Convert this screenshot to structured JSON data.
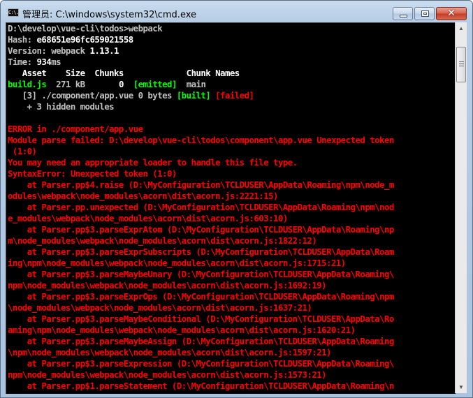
{
  "window": {
    "title": "管理员: C:\\windows\\system32\\cmd.exe",
    "icon": "cmd-icon",
    "icon_text": "C:\\.",
    "buttons": {
      "minimize": "minimize-icon",
      "maximize": "maximize-icon",
      "close": "close-icon",
      "close_glyph": "✕"
    }
  },
  "colors": {
    "console_bg": "#000000",
    "default_text": "#c0c0c0",
    "bright_text": "#ffffff",
    "success": "#00ff00",
    "error": "#ff0000"
  },
  "console": {
    "lines": [
      [
        {
          "t": "D:\\develop\\vue-cli\\todos>webpack",
          "c": "g"
        }
      ],
      [
        {
          "t": "Hash: ",
          "c": "g"
        },
        {
          "t": "e68651e96fc659021558",
          "c": "w"
        }
      ],
      [
        {
          "t": "Version: webpack ",
          "c": "g"
        },
        {
          "t": "1.13.1",
          "c": "w"
        }
      ],
      [
        {
          "t": "Time: ",
          "c": "g"
        },
        {
          "t": "934",
          "c": "w"
        },
        {
          "t": "ms",
          "c": "g"
        }
      ],
      [
        {
          "t": "   Asset    Size  Chunks             Chunk Names",
          "c": "w"
        }
      ],
      [
        {
          "t": "build.js",
          "c": "gr"
        },
        {
          "t": "  271 kB       ",
          "c": "g"
        },
        {
          "t": "0",
          "c": "w"
        },
        {
          "t": "  ",
          "c": "g"
        },
        {
          "t": "[emitted]",
          "c": "gr"
        },
        {
          "t": "  main",
          "c": "g"
        }
      ],
      [
        {
          "t": "   [3] ./component/app.vue 0 bytes ",
          "c": "g"
        },
        {
          "t": "[built]",
          "c": "gr"
        },
        {
          "t": " ",
          "c": "g"
        },
        {
          "t": "[failed]",
          "c": "r"
        }
      ],
      [
        {
          "t": "    + 3 hidden modules",
          "c": "g"
        }
      ],
      [
        {
          "t": "",
          "c": "g"
        }
      ],
      [
        {
          "t": "ERROR in ./component/app.vue",
          "c": "r"
        }
      ],
      [
        {
          "t": "Module parse failed: D:\\develop\\vue-cli\\todos\\component\\app.vue Unexpected token",
          "c": "r"
        }
      ],
      [
        {
          "t": " (1:0)",
          "c": "r"
        }
      ],
      [
        {
          "t": "You may need an appropriate loader to handle this file type.",
          "c": "r"
        }
      ],
      [
        {
          "t": "SyntaxError: Unexpected token (1:0)",
          "c": "r"
        }
      ],
      [
        {
          "t": "    at Parser.pp$4.raise (D:\\MyConfiguration\\TCLDUSER\\AppData\\Roaming\\npm\\node_m",
          "c": "r"
        }
      ],
      [
        {
          "t": "odules\\webpack\\node_modules\\acorn\\dist\\acorn.js:2221:15)",
          "c": "r"
        }
      ],
      [
        {
          "t": "    at Parser.pp.unexpected (D:\\MyConfiguration\\TCLDUSER\\AppData\\Roaming\\npm\\nod",
          "c": "r"
        }
      ],
      [
        {
          "t": "e_modules\\webpack\\node_modules\\acorn\\dist\\acorn.js:603:10)",
          "c": "r"
        }
      ],
      [
        {
          "t": "    at Parser.pp$3.parseExprAtom (D:\\MyConfiguration\\TCLDUSER\\AppData\\Roaming\\np",
          "c": "r"
        }
      ],
      [
        {
          "t": "m\\node_modules\\webpack\\node_modules\\acorn\\dist\\acorn.js:1822:12)",
          "c": "r"
        }
      ],
      [
        {
          "t": "    at Parser.pp$3.parseExprSubscripts (D:\\MyConfiguration\\TCLDUSER\\AppData\\Roam",
          "c": "r"
        }
      ],
      [
        {
          "t": "ing\\npm\\node_modules\\webpack\\node_modules\\acorn\\dist\\acorn.js:1715:21)",
          "c": "r"
        }
      ],
      [
        {
          "t": "    at Parser.pp$3.parseMaybeUnary (D:\\MyConfiguration\\TCLDUSER\\AppData\\Roaming\\",
          "c": "r"
        }
      ],
      [
        {
          "t": "npm\\node_modules\\webpack\\node_modules\\acorn\\dist\\acorn.js:1692:19)",
          "c": "r"
        }
      ],
      [
        {
          "t": "    at Parser.pp$3.parseExprOps (D:\\MyConfiguration\\TCLDUSER\\AppData\\Roaming\\npm",
          "c": "r"
        }
      ],
      [
        {
          "t": "\\node_modules\\webpack\\node_modules\\acorn\\dist\\acorn.js:1637:21)",
          "c": "r"
        }
      ],
      [
        {
          "t": "    at Parser.pp$3.parseMaybeConditional (D:\\MyConfiguration\\TCLDUSER\\AppData\\Ro",
          "c": "r"
        }
      ],
      [
        {
          "t": "aming\\npm\\node_modules\\webpack\\node_modules\\acorn\\dist\\acorn.js:1620:21)",
          "c": "r"
        }
      ],
      [
        {
          "t": "    at Parser.pp$3.parseMaybeAssign (D:\\MyConfiguration\\TCLDUSER\\AppData\\Roaming",
          "c": "r"
        }
      ],
      [
        {
          "t": "\\npm\\node_modules\\webpack\\node_modules\\acorn\\dist\\acorn.js:1597:21)",
          "c": "r"
        }
      ],
      [
        {
          "t": "    at Parser.pp$3.parseExpression (D:\\MyConfiguration\\TCLDUSER\\AppData\\Roaming\\",
          "c": "r"
        }
      ],
      [
        {
          "t": "npm\\node_modules\\webpack\\node_modules\\acorn\\dist\\acorn.js:1573:21)",
          "c": "r"
        }
      ],
      [
        {
          "t": "    at Parser.pp$1.parseStatement (D:\\MyConfiguration\\TCLDUSER\\AppData\\Roaming\\n",
          "c": "r"
        }
      ]
    ]
  },
  "scrollbar": {
    "up_glyph": "▲",
    "down_glyph": "▼",
    "position_fraction": 0.02
  }
}
